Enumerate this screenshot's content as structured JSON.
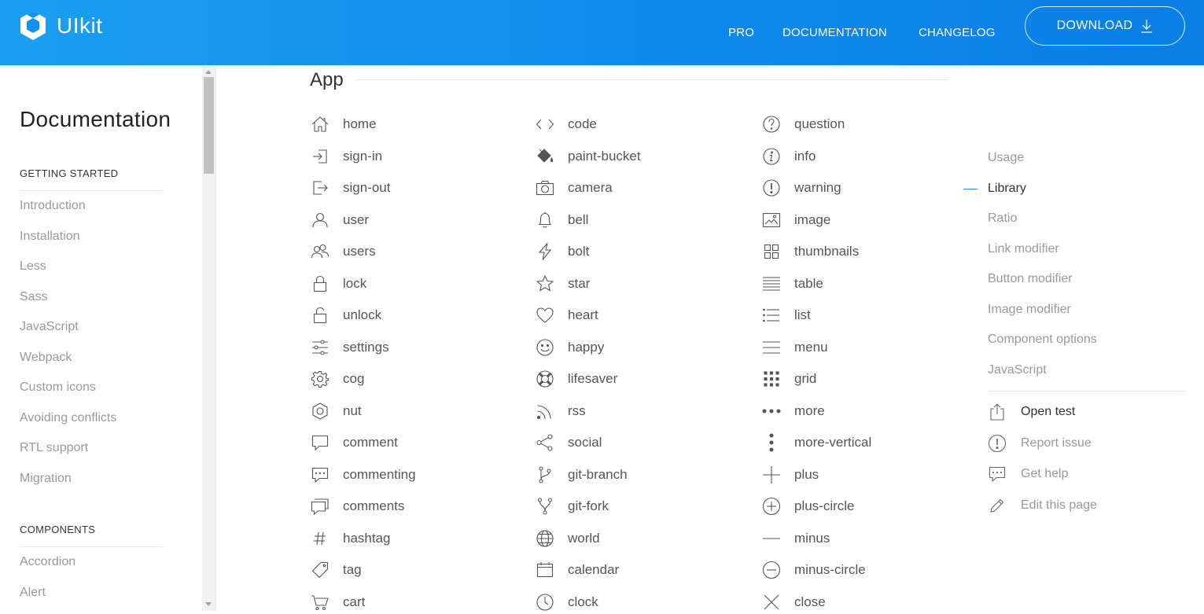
{
  "header": {
    "brand": "UIkit",
    "nav": [
      "PRO",
      "DOCUMENTATION",
      "CHANGELOG"
    ],
    "download_label": "DOWNLOAD"
  },
  "sidebar": {
    "title": "Documentation",
    "sections": [
      {
        "label": "GETTING STARTED",
        "items": [
          "Introduction",
          "Installation",
          "Less",
          "Sass",
          "JavaScript",
          "Webpack",
          "Custom icons",
          "Avoiding conflicts",
          "RTL support",
          "Migration"
        ]
      },
      {
        "label": "COMPONENTS",
        "items": [
          "Accordion",
          "Alert"
        ]
      }
    ]
  },
  "main": {
    "section_title": "App",
    "columns": [
      [
        {
          "name": "home",
          "icon": "home-icon"
        },
        {
          "name": "sign-in",
          "icon": "sign-in-icon"
        },
        {
          "name": "sign-out",
          "icon": "sign-out-icon"
        },
        {
          "name": "user",
          "icon": "user-icon"
        },
        {
          "name": "users",
          "icon": "users-icon"
        },
        {
          "name": "lock",
          "icon": "lock-icon"
        },
        {
          "name": "unlock",
          "icon": "unlock-icon"
        },
        {
          "name": "settings",
          "icon": "settings-icon"
        },
        {
          "name": "cog",
          "icon": "cog-icon"
        },
        {
          "name": "nut",
          "icon": "nut-icon"
        },
        {
          "name": "comment",
          "icon": "comment-icon"
        },
        {
          "name": "commenting",
          "icon": "commenting-icon"
        },
        {
          "name": "comments",
          "icon": "comments-icon"
        },
        {
          "name": "hashtag",
          "icon": "hashtag-icon"
        },
        {
          "name": "tag",
          "icon": "tag-icon"
        },
        {
          "name": "cart",
          "icon": "cart-icon"
        }
      ],
      [
        {
          "name": "code",
          "icon": "code-icon"
        },
        {
          "name": "paint-bucket",
          "icon": "paint-bucket-icon"
        },
        {
          "name": "camera",
          "icon": "camera-icon"
        },
        {
          "name": "bell",
          "icon": "bell-icon"
        },
        {
          "name": "bolt",
          "icon": "bolt-icon"
        },
        {
          "name": "star",
          "icon": "star-icon"
        },
        {
          "name": "heart",
          "icon": "heart-icon"
        },
        {
          "name": "happy",
          "icon": "happy-icon"
        },
        {
          "name": "lifesaver",
          "icon": "lifesaver-icon"
        },
        {
          "name": "rss",
          "icon": "rss-icon"
        },
        {
          "name": "social",
          "icon": "social-icon"
        },
        {
          "name": "git-branch",
          "icon": "git-branch-icon"
        },
        {
          "name": "git-fork",
          "icon": "git-fork-icon"
        },
        {
          "name": "world",
          "icon": "world-icon"
        },
        {
          "name": "calendar",
          "icon": "calendar-icon"
        },
        {
          "name": "clock",
          "icon": "clock-icon"
        }
      ],
      [
        {
          "name": "question",
          "icon": "question-icon"
        },
        {
          "name": "info",
          "icon": "info-icon"
        },
        {
          "name": "warning",
          "icon": "warning-icon"
        },
        {
          "name": "image",
          "icon": "image-icon"
        },
        {
          "name": "thumbnails",
          "icon": "thumbnails-icon"
        },
        {
          "name": "table",
          "icon": "table-icon"
        },
        {
          "name": "list",
          "icon": "list-icon"
        },
        {
          "name": "menu",
          "icon": "menu-icon"
        },
        {
          "name": "grid",
          "icon": "grid-icon"
        },
        {
          "name": "more",
          "icon": "more-icon"
        },
        {
          "name": "more-vertical",
          "icon": "more-vertical-icon"
        },
        {
          "name": "plus",
          "icon": "plus-icon"
        },
        {
          "name": "plus-circle",
          "icon": "plus-circle-icon"
        },
        {
          "name": "minus",
          "icon": "minus-icon"
        },
        {
          "name": "minus-circle",
          "icon": "minus-circle-icon"
        },
        {
          "name": "close",
          "icon": "close-icon"
        }
      ]
    ]
  },
  "toc": {
    "items": [
      "Usage",
      "Library",
      "Ratio",
      "Link modifier",
      "Button modifier",
      "Image modifier",
      "Component options",
      "JavaScript"
    ],
    "active": "Library",
    "actions": [
      {
        "label": "Open test",
        "icon": "open-test-icon"
      },
      {
        "label": "Report issue",
        "icon": "report-issue-icon"
      },
      {
        "label": "Get help",
        "icon": "get-help-icon"
      },
      {
        "label": "Edit this page",
        "icon": "edit-page-icon"
      }
    ]
  },
  "colors": {
    "header_start": "#1a9ff0",
    "header_end": "#0a7fe6",
    "accent": "#1e87f0",
    "muted_text": "#999999"
  }
}
